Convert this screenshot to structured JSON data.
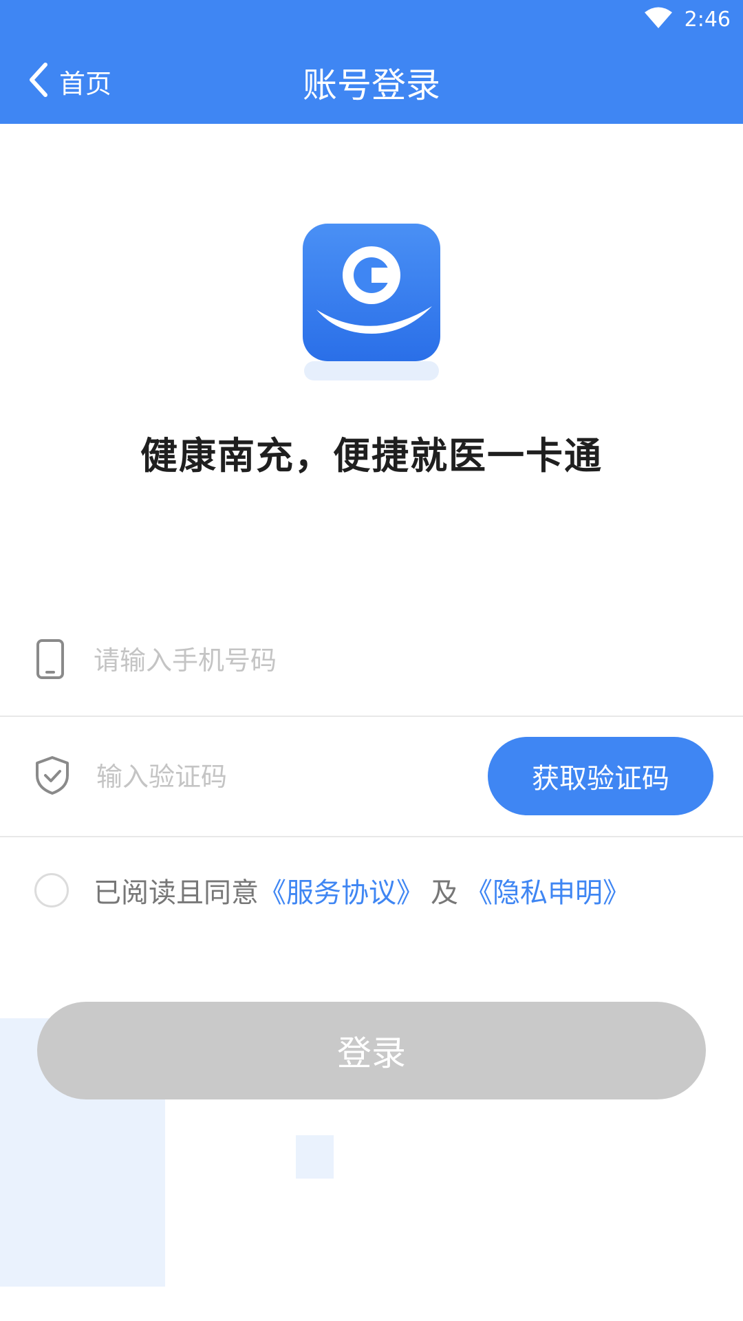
{
  "status_bar": {
    "time": "2:46",
    "wifi_icon": "wifi-icon"
  },
  "header": {
    "back_label": "首页",
    "title": "账号登录",
    "background_color": "#3f86f3"
  },
  "brand": {
    "logo_icon": "hand-holding-c-logo",
    "slogan": "健康南充，便捷就医一卡通"
  },
  "form": {
    "phone": {
      "icon": "phone-icon",
      "placeholder": "请输入手机号码",
      "value": ""
    },
    "code": {
      "icon": "shield-check-icon",
      "placeholder": "输入验证码",
      "value": ""
    },
    "get_code_label": "获取验证码",
    "agreement": {
      "prefix": "已阅读且同意",
      "service_link": "《服务协议》",
      "and": "及",
      "privacy_link": "《隐私申明》",
      "checked": false
    },
    "login_label": "登录"
  },
  "colors": {
    "accent": "#3f86f3",
    "disabled_button": "#c9c9c9",
    "placeholder": "#c4c4c4"
  }
}
